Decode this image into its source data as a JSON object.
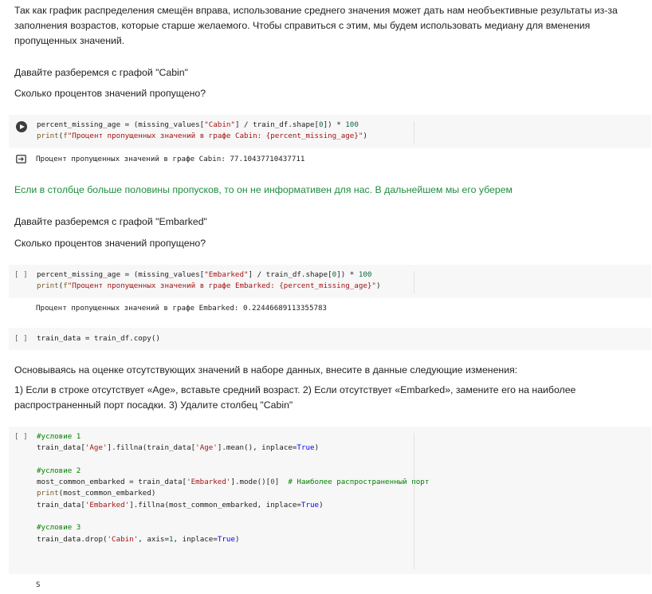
{
  "texts": {
    "intro": "Так как график распределения смещён вправа, использование среднего значения может дать нам необъективные результаты из-за\nзаполнения возрастов, которые старше желаемого. Чтобы справиться с этим, мы будем использовать медиану для вменения\nпропущенных значений.",
    "cabin_heading": "Давайте разберемся с графой \"Cabin\"",
    "cabin_question": "Сколько процентов значений пропущено?",
    "cabin_note": "Если в столбце больше половины пропусков, то он не информативен для нас. В дальнейшем мы его уберем",
    "embarked_heading": "Давайте разберемся с графой \"Embarked\"",
    "embarked_question": "Сколько процентов значений пропущено?",
    "changes_intro": "Основываясь на оценке отсутствующих значений в наборе данных, внесите в данные следующие изменения:",
    "changes_list": "1) Если в строке отсутствует «Age», вставьте средний возраст. 2) Если отсутствует «Embarked», замените его на наиболее\nраспространенный порт посадки. 3) Удалите столбец \"Cabin\""
  },
  "cells": {
    "cabin_code": [
      "percent_missing_age = (missing_values[\"Cabin\"] / train_df.shape[0]) * 100",
      "print(f\"Процент пропущенных значений в графе Cabin: {percent_missing_age}\")"
    ],
    "cabin_output": "Процент пропущенных значений в графе Cabin: 77.10437710437711",
    "embarked_brackets": "[ ]",
    "embarked_code": [
      "percent_missing_age = (missing_values[\"Embarked\"] / train_df.shape[0]) * 100",
      "print(f\"Процент пропущенных значений в графе Embarked: {percent_missing_age}\")"
    ],
    "embarked_output": "Процент пропущенных значений в графе Embarked: 0.22446689113355783",
    "copy_brackets": "[ ]",
    "copy_code": "train_data = train_df.copy()",
    "changes_brackets": "[ ]",
    "changes_code": [
      "#условие 1",
      "train_data['Age'].fillna(train_data['Age'].mean(), inplace=True)",
      "",
      "#условие 2",
      "most_common_embarked = train_data['Embarked'].mode()[0]  # Наиболее распространенный порт",
      "print(most_common_embarked)",
      "train_data['Embarked'].fillna(most_common_embarked, inplace=True)",
      "",
      "#условие 3",
      "train_data.drop('Cabin', axis=1, inplace=True)"
    ],
    "changes_output": "S"
  },
  "icons": {
    "run": "play-circle-icon",
    "output": "output-arrow-icon"
  }
}
